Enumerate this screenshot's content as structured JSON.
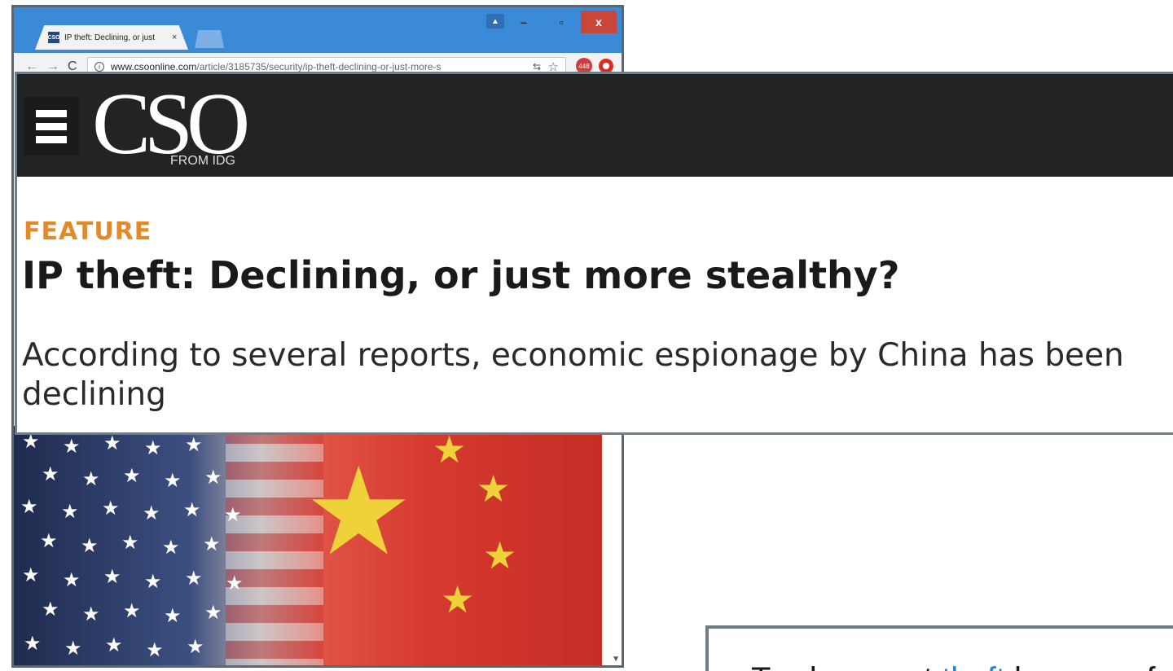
{
  "browser": {
    "tab_favicon": "CSO",
    "tab_title": "IP theft: Declining, or just",
    "tab_close": "×",
    "window_buttons": {
      "minimize": "–",
      "maximize": "▫",
      "close": "x"
    },
    "url_domain": "www.csoonline.com",
    "url_path": "/article/3185735/security/ip-theft-declining-or-just-more-s",
    "extension_badge": "448",
    "icons": [
      "back-icon",
      "forward-icon",
      "reload-icon",
      "info-icon",
      "translate-icon",
      "star-icon",
      "extension-icon",
      "adblock-icon"
    ]
  },
  "site": {
    "logo": "CSO",
    "logo_sub": "FROM IDG"
  },
  "article": {
    "eyebrow": "FEATURE",
    "headline": "IP theft: Declining, or just more stealthy?",
    "dek": "According to several reports, economic espionage by China has been declining"
  },
  "callout2": {
    "text_before": "Trade secret ",
    "link_text": "theft",
    "text_after": " by some f"
  },
  "colors": {
    "header_bg": "#222324",
    "eyebrow": "#e18a2c",
    "browser_chrome": "#3b8ad7",
    "close_button": "#c9473a",
    "link": "#2a85c8"
  }
}
